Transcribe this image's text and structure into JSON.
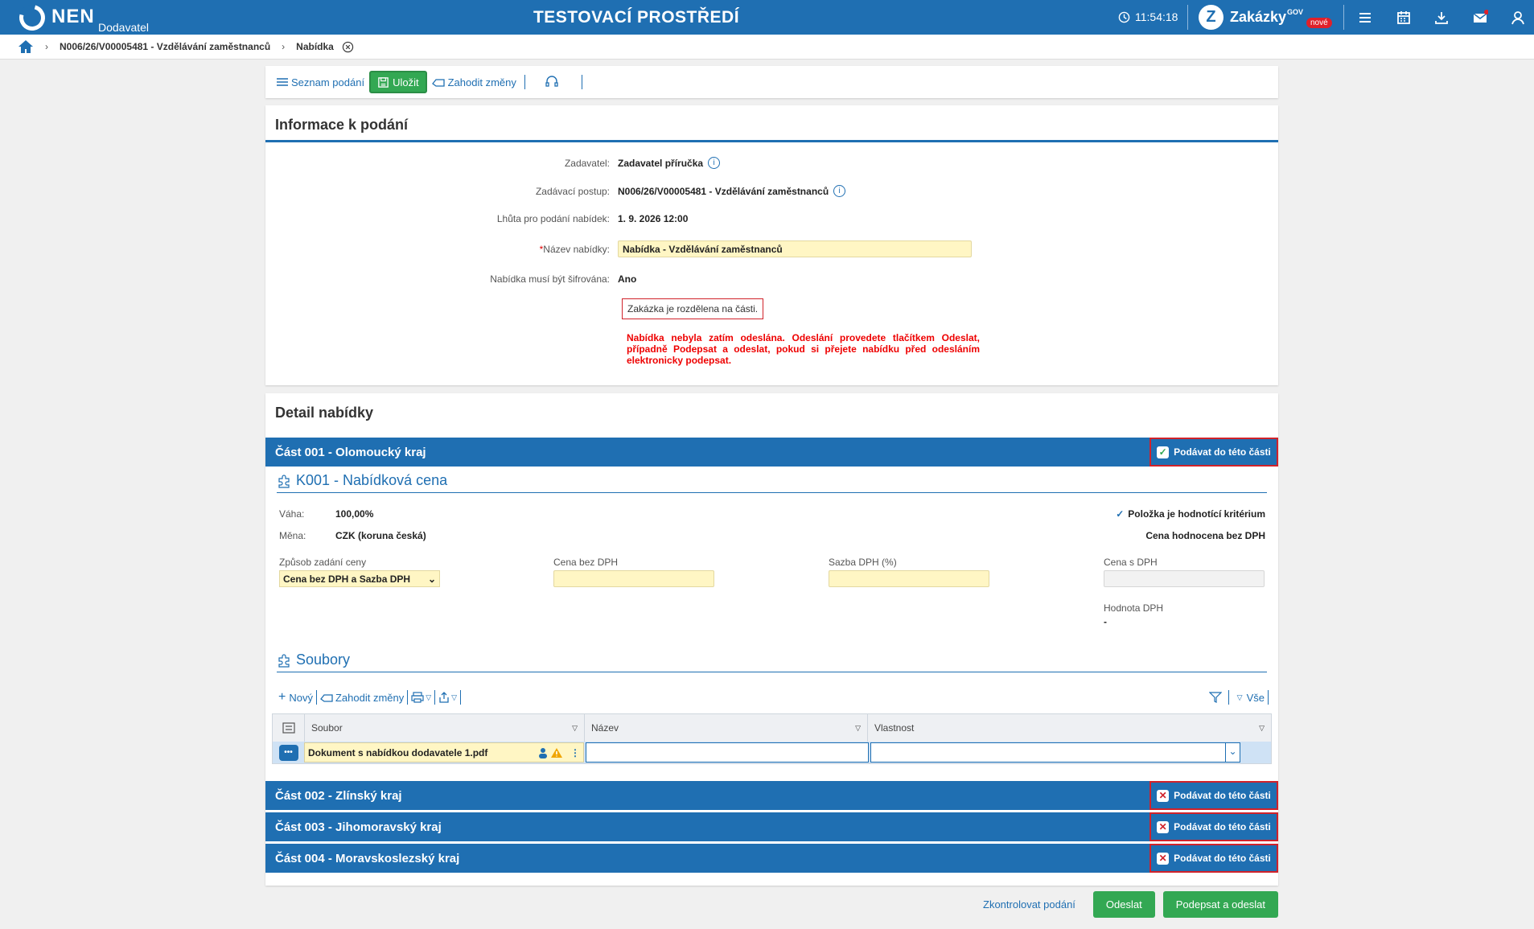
{
  "header": {
    "app_name": "NEN",
    "app_sub": "Dodavatel",
    "environment": "TESTOVACÍ PROSTŘEDÍ",
    "time": "11:54:18",
    "portal_name": "Zakázky",
    "portal_gov": "GOV",
    "portal_badge": "nové",
    "icons": [
      "menu-icon",
      "calendar-icon",
      "download-icon",
      "mail-icon",
      "user-icon"
    ]
  },
  "breadcrumb": {
    "item1": "N006/26/V00005481 - Vzdělávání zaměstnanců",
    "item2": "Nabídka"
  },
  "toolbar": {
    "list_label": "Seznam podání",
    "save_label": "Uložit",
    "discard_label": "Zahodit změny"
  },
  "info": {
    "title": "Informace k podání",
    "zadavatel_label": "Zadavatel:",
    "zadavatel_value": "Zadavatel příručka",
    "postup_label": "Zadávací postup:",
    "postup_value": "N006/26/V00005481 - Vzdělávání zaměstnanců",
    "lhuta_label": "Lhůta pro podání nabídek:",
    "lhuta_value": "1. 9. 2026 12:00",
    "nazev_label": "Název nabídky:",
    "nazev_value": "Nabídka - Vzdělávání zaměstnanců",
    "sifr_label": "Nabídka musí být šifrována:",
    "sifr_value": "Ano",
    "parts_note": "Zakázka je rozdělena na části.",
    "warning": "Nabídka nebyla zatím odeslána. Odeslání provedete tlačítkem Odeslat, případně Podepsat a odeslat, pokud si přejete nabídku před odesláním elektronicky podepsat."
  },
  "detail": {
    "title": "Detail nabídky",
    "submit_part_label": "Podávat do této části",
    "parts": [
      {
        "title": "Část 001 - Olomoucký kraj",
        "checked": true
      },
      {
        "title": "Část 002 - Zlínský kraj",
        "checked": false
      },
      {
        "title": "Část 003 - Jihomoravský kraj",
        "checked": false
      },
      {
        "title": "Část 004 - Moravskoslezský kraj",
        "checked": false
      }
    ],
    "criterion": {
      "title": "K001 - Nabídková cena",
      "vaha_label": "Váha:",
      "vaha_value": "100,00%",
      "mena_label": "Měna:",
      "mena_value": "CZK (koruna česká)",
      "hodnotici": "Položka je hodnotící kritérium",
      "hodnocena": "Cena hodnocena bez DPH",
      "zpusob_label": "Způsob zadání ceny",
      "zpusob_value": "Cena bez DPH a Sazba DPH",
      "cena_bez_label": "Cena bez DPH",
      "sazba_label": "Sazba DPH (%)",
      "cena_s_label": "Cena s DPH",
      "hodnota_label": "Hodnota DPH",
      "hodnota_value": "-"
    },
    "files": {
      "title": "Soubory",
      "new_label": "Nový",
      "discard_label": "Zahodit změny",
      "all_label": "Vše",
      "columns": [
        "Soubor",
        "Název",
        "Vlastnost"
      ],
      "row_file": "Dokument s nabídkou dodavatele 1.pdf"
    }
  },
  "footer": {
    "check_label": "Zkontrolovat podání",
    "send_label": "Odeslat",
    "sign_send_label": "Podepsat a odeslat"
  }
}
